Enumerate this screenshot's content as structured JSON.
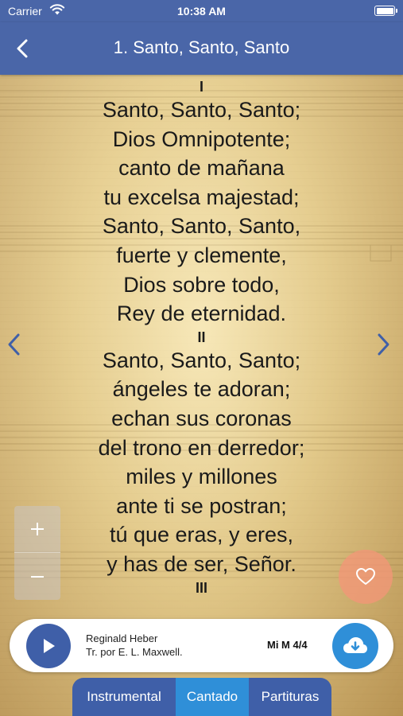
{
  "status_bar": {
    "carrier": "Carrier",
    "time": "10:38 AM"
  },
  "nav": {
    "title": "1. Santo, Santo, Santo",
    "back_icon": "chevron-left-icon"
  },
  "lyrics": {
    "stanzas": [
      {
        "number": "I",
        "lines": [
          "Santo, Santo, Santo;",
          "Dios Omnipotente;",
          "canto de mañana",
          "tu excelsa majestad;",
          "Santo, Santo, Santo,",
          "fuerte y clemente,",
          "Dios sobre todo,",
          "Rey de eternidad."
        ]
      },
      {
        "number": "II",
        "lines": [
          "Santo, Santo, Santo;",
          "ángeles te adoran;",
          "echan sus coronas",
          "del trono en derredor;",
          "miles y millones",
          "ante ti se postran;",
          "tú que eras, y eres,",
          "y has de ser, Señor."
        ]
      },
      {
        "number": "III",
        "lines": []
      }
    ]
  },
  "zoom": {
    "in_icon": "plus-icon",
    "out_icon": "minus-icon"
  },
  "player": {
    "author": "Reginald Heber",
    "translator": "Tr. por E. L. Maxwell.",
    "key_signature": "Mi M 4/4"
  },
  "tabs": [
    "Instrumental",
    "Cantado",
    "Partituras"
  ],
  "active_tab": "Cantado",
  "colors": {
    "nav": "#4a66a8",
    "accent": "#2f8fd8",
    "favorite": "#f49678"
  }
}
